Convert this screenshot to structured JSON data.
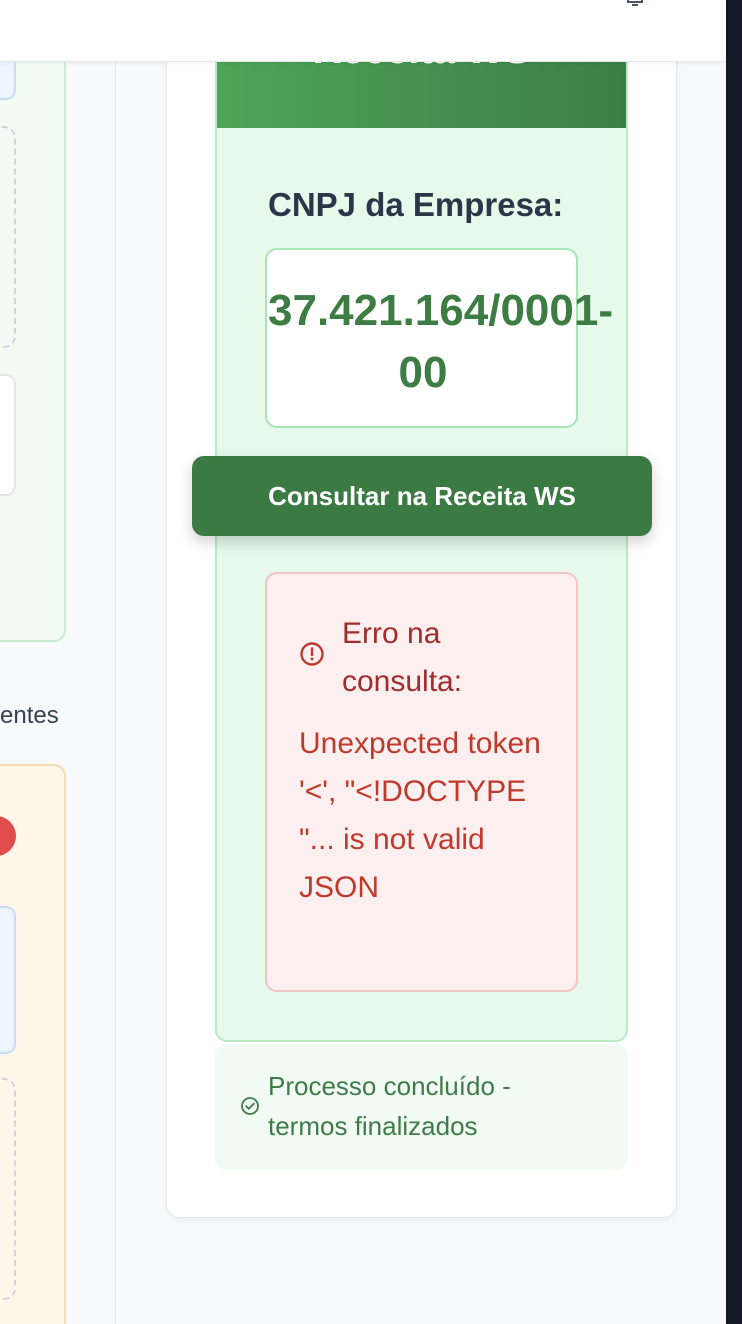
{
  "left_panel": {
    "partial_text": "entes"
  },
  "card": {
    "header_title": "Receita WS",
    "cnpj_label": "CNPJ da Empresa:",
    "cnpj_value": "37.421.164/0001-\n00",
    "consult_button_label": "Consultar na Receita WS",
    "error": {
      "title": "Erro na consulta:",
      "message": "Unexpected token '<', \"<!DOCTYPE \"... is not valid JSON",
      "icon": "alert-circle-icon"
    },
    "status": {
      "text": "Processo concluído - termos finalizados",
      "icon": "check-circle-icon"
    }
  },
  "colors": {
    "primary_green": "#3b7a42",
    "error_red": "#c0392b",
    "panel_green_bg": "#e6f9ea"
  }
}
